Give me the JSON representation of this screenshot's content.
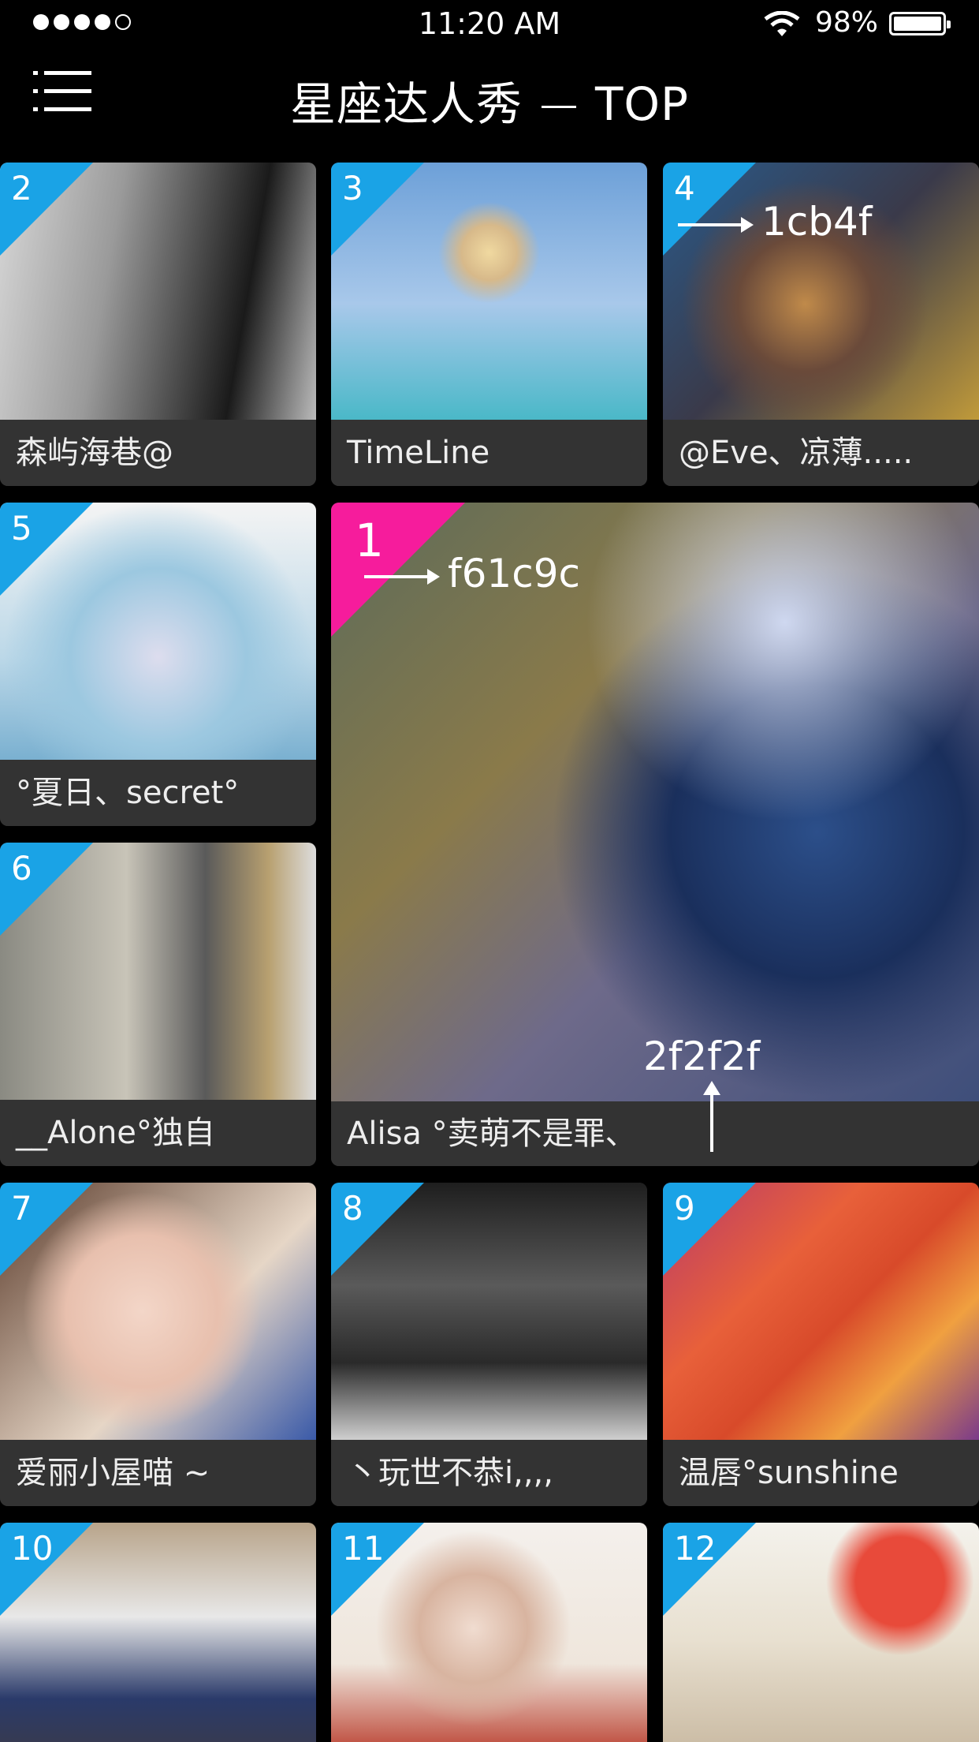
{
  "status": {
    "time": "11:20 AM",
    "battery": "98%"
  },
  "header": {
    "title_main": "星座达人秀",
    "title_suffix": "TOP"
  },
  "colors": {
    "rank_blue": "#1aa3e6",
    "rank_pink": "#f61c9c",
    "caption_bg": "#333333",
    "background": "#000000"
  },
  "tiles": [
    {
      "rank": "1",
      "name": "Alisa  °卖萌不是罪、",
      "featured": true
    },
    {
      "rank": "2",
      "name": "森屿海巷@"
    },
    {
      "rank": "3",
      "name": "TimeLine"
    },
    {
      "rank": "4",
      "name": "@Eve、凉薄....."
    },
    {
      "rank": "5",
      "name": "°夏日、secret°"
    },
    {
      "rank": "6",
      "name": "__Alone°独自"
    },
    {
      "rank": "7",
      "name": "爱丽小屋喵 ~"
    },
    {
      "rank": "8",
      "name": "丶玩世不恭i,,,,"
    },
    {
      "rank": "9",
      "name": "温唇°sunshine"
    },
    {
      "rank": "10",
      "name": ""
    },
    {
      "rank": "11",
      "name": ""
    },
    {
      "rank": "12",
      "name": ""
    }
  ],
  "annotations": {
    "tile4_color": "1cb4f",
    "tile1_color": "f61c9c",
    "caption_color": "2f2f2f"
  }
}
